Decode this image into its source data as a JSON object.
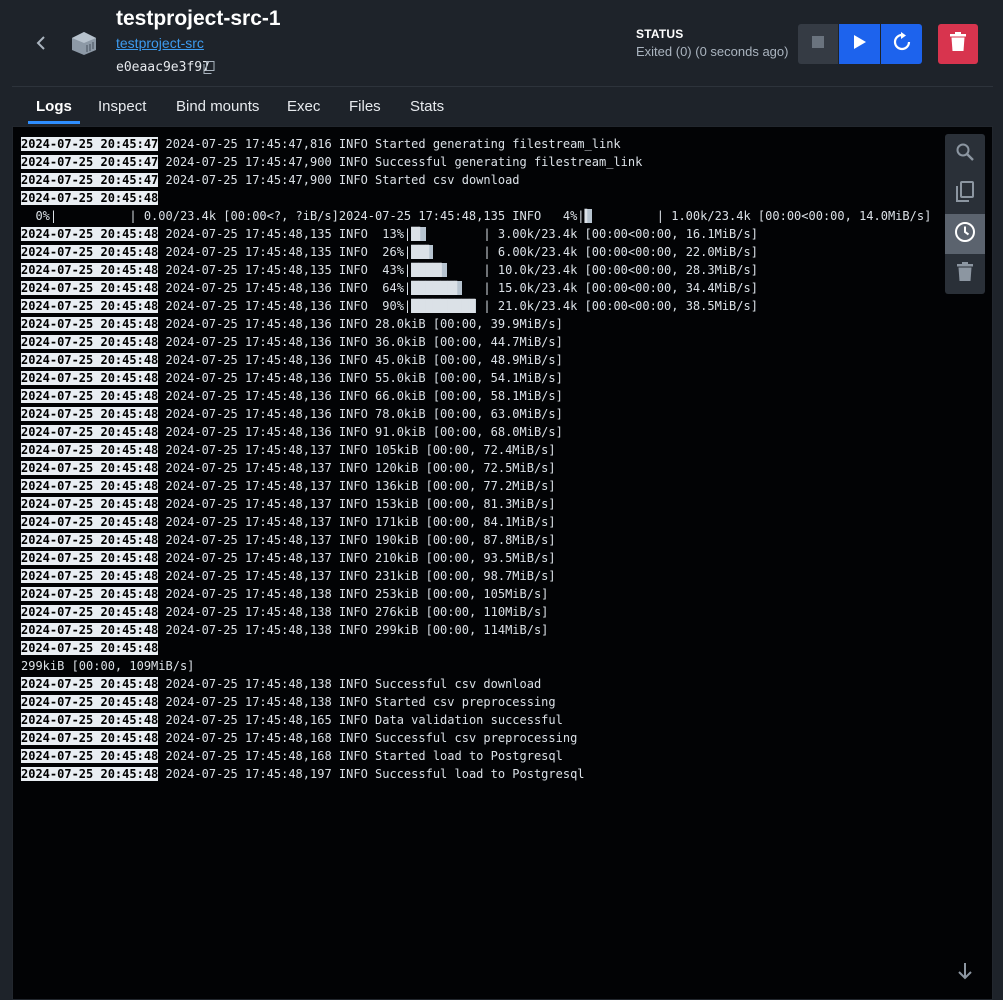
{
  "header": {
    "title": "testproject-src-1",
    "project_link": "testproject-src",
    "container_id": "e0eaac9e3f97",
    "status_label": "STATUS",
    "status_value": "Exited (0) (0 seconds ago)"
  },
  "tabs": [
    {
      "label": "Logs",
      "active": true
    },
    {
      "label": "Inspect",
      "active": false
    },
    {
      "label": "Bind mounts",
      "active": false
    },
    {
      "label": "Exec",
      "active": false
    },
    {
      "label": "Files",
      "active": false
    },
    {
      "label": "Stats",
      "active": false
    }
  ],
  "actions": {
    "stop": "stop-icon",
    "start": "play-icon",
    "restart": "restart-icon",
    "delete": "trash-icon"
  },
  "log_toolbar": [
    "search-icon",
    "copy-icon",
    "clock-icon",
    "trash-icon"
  ],
  "colors": {
    "background": "#1e232a",
    "log_background": "#020305",
    "accent_blue": "#1d63ed",
    "danger_red": "#d8344e",
    "link_blue": "#3d9bef"
  },
  "logs": [
    {
      "ts": "2024-07-25 20:45:47",
      "msg": " 2024-07-25 17:45:47,816 INFO Started generating filestream_link"
    },
    {
      "ts": "2024-07-25 20:45:47",
      "msg": " 2024-07-25 17:45:47,900 INFO Successful generating filestream_link"
    },
    {
      "ts": "2024-07-25 20:45:47",
      "msg": " 2024-07-25 17:45:47,900 INFO Started csv download"
    },
    {
      "ts": "2024-07-25 20:45:48",
      "msg": ""
    },
    {
      "ts": "",
      "msg": "  0%|          | 0.00/23.4k [00:00<?, ?iB/s]2024-07-25 17:45:48,135 INFO   4%|▍         | 1.00k/23.4k [00:00<00:00, 14.0MiB/s]"
    },
    {
      "ts": "2024-07-25 20:45:48",
      "msg": " 2024-07-25 17:45:48,135 INFO  13%|█▎        | 3.00k/23.4k [00:00<00:00, 16.1MiB/s]"
    },
    {
      "ts": "2024-07-25 20:45:48",
      "msg": " 2024-07-25 17:45:48,135 INFO  26%|██▌       | 6.00k/23.4k [00:00<00:00, 22.0MiB/s]"
    },
    {
      "ts": "2024-07-25 20:45:48",
      "msg": " 2024-07-25 17:45:48,135 INFO  43%|████▎     | 10.0k/23.4k [00:00<00:00, 28.3MiB/s]"
    },
    {
      "ts": "2024-07-25 20:45:48",
      "msg": " 2024-07-25 17:45:48,136 INFO  64%|██████▍   | 15.0k/23.4k [00:00<00:00, 34.4MiB/s]"
    },
    {
      "ts": "2024-07-25 20:45:48",
      "msg": " 2024-07-25 17:45:48,136 INFO  90%|████████▉ | 21.0k/23.4k [00:00<00:00, 38.5MiB/s]"
    },
    {
      "ts": "2024-07-25 20:45:48",
      "msg": " 2024-07-25 17:45:48,136 INFO 28.0kiB [00:00, 39.9MiB/s]"
    },
    {
      "ts": "2024-07-25 20:45:48",
      "msg": " 2024-07-25 17:45:48,136 INFO 36.0kiB [00:00, 44.7MiB/s]"
    },
    {
      "ts": "2024-07-25 20:45:48",
      "msg": " 2024-07-25 17:45:48,136 INFO 45.0kiB [00:00, 48.9MiB/s]"
    },
    {
      "ts": "2024-07-25 20:45:48",
      "msg": " 2024-07-25 17:45:48,136 INFO 55.0kiB [00:00, 54.1MiB/s]"
    },
    {
      "ts": "2024-07-25 20:45:48",
      "msg": " 2024-07-25 17:45:48,136 INFO 66.0kiB [00:00, 58.1MiB/s]"
    },
    {
      "ts": "2024-07-25 20:45:48",
      "msg": " 2024-07-25 17:45:48,136 INFO 78.0kiB [00:00, 63.0MiB/s]"
    },
    {
      "ts": "2024-07-25 20:45:48",
      "msg": " 2024-07-25 17:45:48,136 INFO 91.0kiB [00:00, 68.0MiB/s]"
    },
    {
      "ts": "2024-07-25 20:45:48",
      "msg": " 2024-07-25 17:45:48,137 INFO 105kiB [00:00, 72.4MiB/s]"
    },
    {
      "ts": "2024-07-25 20:45:48",
      "msg": " 2024-07-25 17:45:48,137 INFO 120kiB [00:00, 72.5MiB/s]"
    },
    {
      "ts": "2024-07-25 20:45:48",
      "msg": " 2024-07-25 17:45:48,137 INFO 136kiB [00:00, 77.2MiB/s]"
    },
    {
      "ts": "2024-07-25 20:45:48",
      "msg": " 2024-07-25 17:45:48,137 INFO 153kiB [00:00, 81.3MiB/s]"
    },
    {
      "ts": "2024-07-25 20:45:48",
      "msg": " 2024-07-25 17:45:48,137 INFO 171kiB [00:00, 84.1MiB/s]"
    },
    {
      "ts": "2024-07-25 20:45:48",
      "msg": " 2024-07-25 17:45:48,137 INFO 190kiB [00:00, 87.8MiB/s]"
    },
    {
      "ts": "2024-07-25 20:45:48",
      "msg": " 2024-07-25 17:45:48,137 INFO 210kiB [00:00, 93.5MiB/s]"
    },
    {
      "ts": "2024-07-25 20:45:48",
      "msg": " 2024-07-25 17:45:48,137 INFO 231kiB [00:00, 98.7MiB/s]"
    },
    {
      "ts": "2024-07-25 20:45:48",
      "msg": " 2024-07-25 17:45:48,138 INFO 253kiB [00:00, 105MiB/s]"
    },
    {
      "ts": "2024-07-25 20:45:48",
      "msg": " 2024-07-25 17:45:48,138 INFO 276kiB [00:00, 110MiB/s]"
    },
    {
      "ts": "2024-07-25 20:45:48",
      "msg": " 2024-07-25 17:45:48,138 INFO 299kiB [00:00, 114MiB/s]"
    },
    {
      "ts": "2024-07-25 20:45:48",
      "msg": ""
    },
    {
      "ts": "",
      "msg": "299kiB [00:00, 109MiB/s]"
    },
    {
      "ts": "2024-07-25 20:45:48",
      "msg": " 2024-07-25 17:45:48,138 INFO Successful csv download"
    },
    {
      "ts": "2024-07-25 20:45:48",
      "msg": " 2024-07-25 17:45:48,138 INFO Started csv preprocessing"
    },
    {
      "ts": "2024-07-25 20:45:48",
      "msg": " 2024-07-25 17:45:48,165 INFO Data validation successful"
    },
    {
      "ts": "2024-07-25 20:45:48",
      "msg": " 2024-07-25 17:45:48,168 INFO Successful csv preprocessing"
    },
    {
      "ts": "2024-07-25 20:45:48",
      "msg": " 2024-07-25 17:45:48,168 INFO Started load to Postgresql"
    },
    {
      "ts": "2024-07-25 20:45:48",
      "msg": " 2024-07-25 17:45:48,197 INFO Successful load to Postgresql"
    }
  ]
}
